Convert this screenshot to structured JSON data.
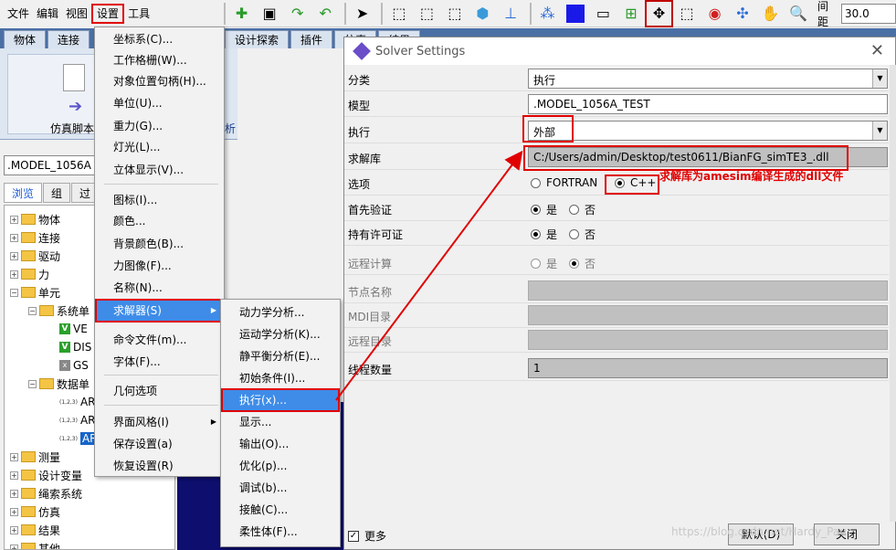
{
  "menubar": {
    "items": [
      "文件",
      "编辑",
      "视图",
      "设置",
      "工具"
    ]
  },
  "toolbar": {
    "spacing_label": "间距",
    "spacing_value": "30.0"
  },
  "ribbon": {
    "tabs": [
      "物体",
      "连接",
      "设计探索",
      "插件",
      "仿真",
      "结果"
    ],
    "script_label": "仿真脚本",
    "analysis_label": "析"
  },
  "left_panel": {
    "model": ".MODEL_1056A",
    "tabs": [
      "浏览",
      "组",
      "过"
    ],
    "tree": [
      {
        "label": "物体"
      },
      {
        "label": "连接"
      },
      {
        "label": "驱动"
      },
      {
        "label": "力"
      },
      {
        "label": "单元"
      },
      {
        "label": "系统单"
      },
      {
        "label": "VE"
      },
      {
        "label": "DIS"
      },
      {
        "label": "GS"
      },
      {
        "label": "数据单"
      },
      {
        "label": "AR"
      },
      {
        "label": "AR"
      },
      {
        "label": "AR"
      },
      {
        "label": "测量"
      },
      {
        "label": "设计变量"
      },
      {
        "label": "绳索系统"
      },
      {
        "label": "仿真"
      },
      {
        "label": "结果"
      },
      {
        "label": "其他"
      }
    ]
  },
  "settings_menu": {
    "items": [
      "坐标系(C)...",
      "工作格栅(W)...",
      "对象位置句柄(H)...",
      "单位(U)...",
      "重力(G)...",
      "灯光(L)...",
      "立体显示(V)...",
      "图标(I)...",
      "颜色...",
      "背景颜色(B)...",
      "力图像(F)...",
      "名称(N)...",
      "求解器(S)",
      "命令文件(m)...",
      "字体(F)...",
      "几何选项",
      "界面风格(I)",
      "保存设置(a)",
      "恢复设置(R)"
    ]
  },
  "solver_menu": {
    "items": [
      "动力学分析...",
      "运动学分析(K)...",
      "静平衡分析(E)...",
      "初始条件(I)...",
      "执行(x)...",
      "显示...",
      "输出(O)...",
      "优化(p)...",
      "调试(b)...",
      "接触(C)...",
      "柔性体(F)..."
    ]
  },
  "dialog": {
    "title": "Solver Settings",
    "close": "✕",
    "rows": {
      "category_label": "分类",
      "category_value": "执行",
      "model_label": "模型",
      "model_value": ".MODEL_1056A_TEST",
      "exec_label": "执行",
      "exec_value": "外部",
      "lib_label": "求解库",
      "lib_value": "C:/Users/admin/Desktop/test0611/BianFG_simTE3_.dll",
      "options_label": "选项",
      "opt_fortran": "FORTRAN",
      "opt_cpp": "C++",
      "verify_label": "首先验证",
      "yes": "是",
      "no": "否",
      "license_label": "持有许可证",
      "remote_label": "远程计算",
      "node_label": "节点名称",
      "mdi_label": "MDI目录",
      "remote_dir_label": "远程目录",
      "threads_label": "线程数量",
      "threads_value": "1"
    },
    "annotation": "求解库为amesim编译生成的dll文件",
    "more_label": "更多",
    "default_button": "默认(D)",
    "close_button": "关闭"
  },
  "watermark": "https://blog.csdn.net/Hardy_Pau"
}
